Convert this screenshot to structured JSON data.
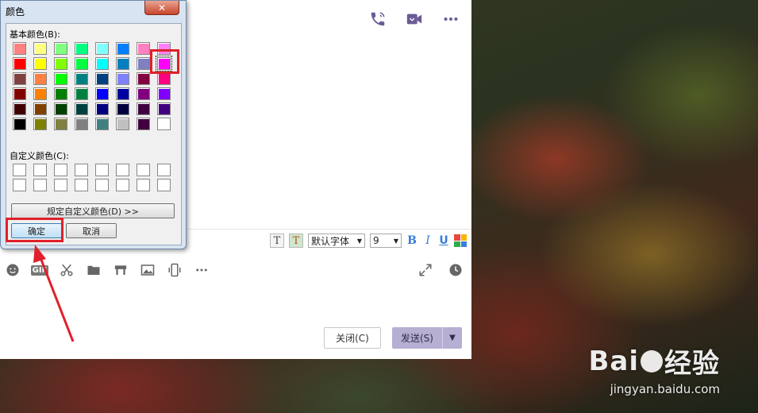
{
  "chat": {
    "format_bar": {
      "font_select": "默认字体",
      "size_select": "9",
      "bold": "B",
      "italic": "I",
      "underline": "U"
    },
    "buttons": {
      "close_label": "关闭(C)",
      "send_label": "发送(S)"
    }
  },
  "color_dialog": {
    "title": "颜色",
    "close_label": "✕",
    "basic_label": "基本颜色(B):",
    "custom_label": "自定义颜色(C):",
    "define_label": "规定自定义颜色(D) >>",
    "ok_label": "确定",
    "cancel_label": "取消",
    "selected_color": "#ff00ff",
    "basic_colors": [
      [
        "#ff8080",
        "#ffff80",
        "#80ff80",
        "#00ff80",
        "#80ffff",
        "#0080ff",
        "#ff80c0",
        "#ff80ff"
      ],
      [
        "#ff0000",
        "#ffff00",
        "#80ff00",
        "#00ff40",
        "#00ffff",
        "#0080c0",
        "#8080c0",
        "#ff00ff"
      ],
      [
        "#804040",
        "#ff8040",
        "#00ff00",
        "#008080",
        "#004080",
        "#8080ff",
        "#800040",
        "#ff0080"
      ],
      [
        "#800000",
        "#ff8000",
        "#008000",
        "#008040",
        "#0000ff",
        "#0000a0",
        "#800080",
        "#8000ff"
      ],
      [
        "#400000",
        "#804000",
        "#004000",
        "#004040",
        "#000080",
        "#000040",
        "#400040",
        "#400080"
      ],
      [
        "#000000",
        "#808000",
        "#808040",
        "#808080",
        "#408080",
        "#c0c0c0",
        "#400040",
        "#ffffff"
      ]
    ]
  },
  "watermark": {
    "logo_left": "Bai",
    "logo_right": "经验",
    "url": "jingyan.baidu.com"
  }
}
